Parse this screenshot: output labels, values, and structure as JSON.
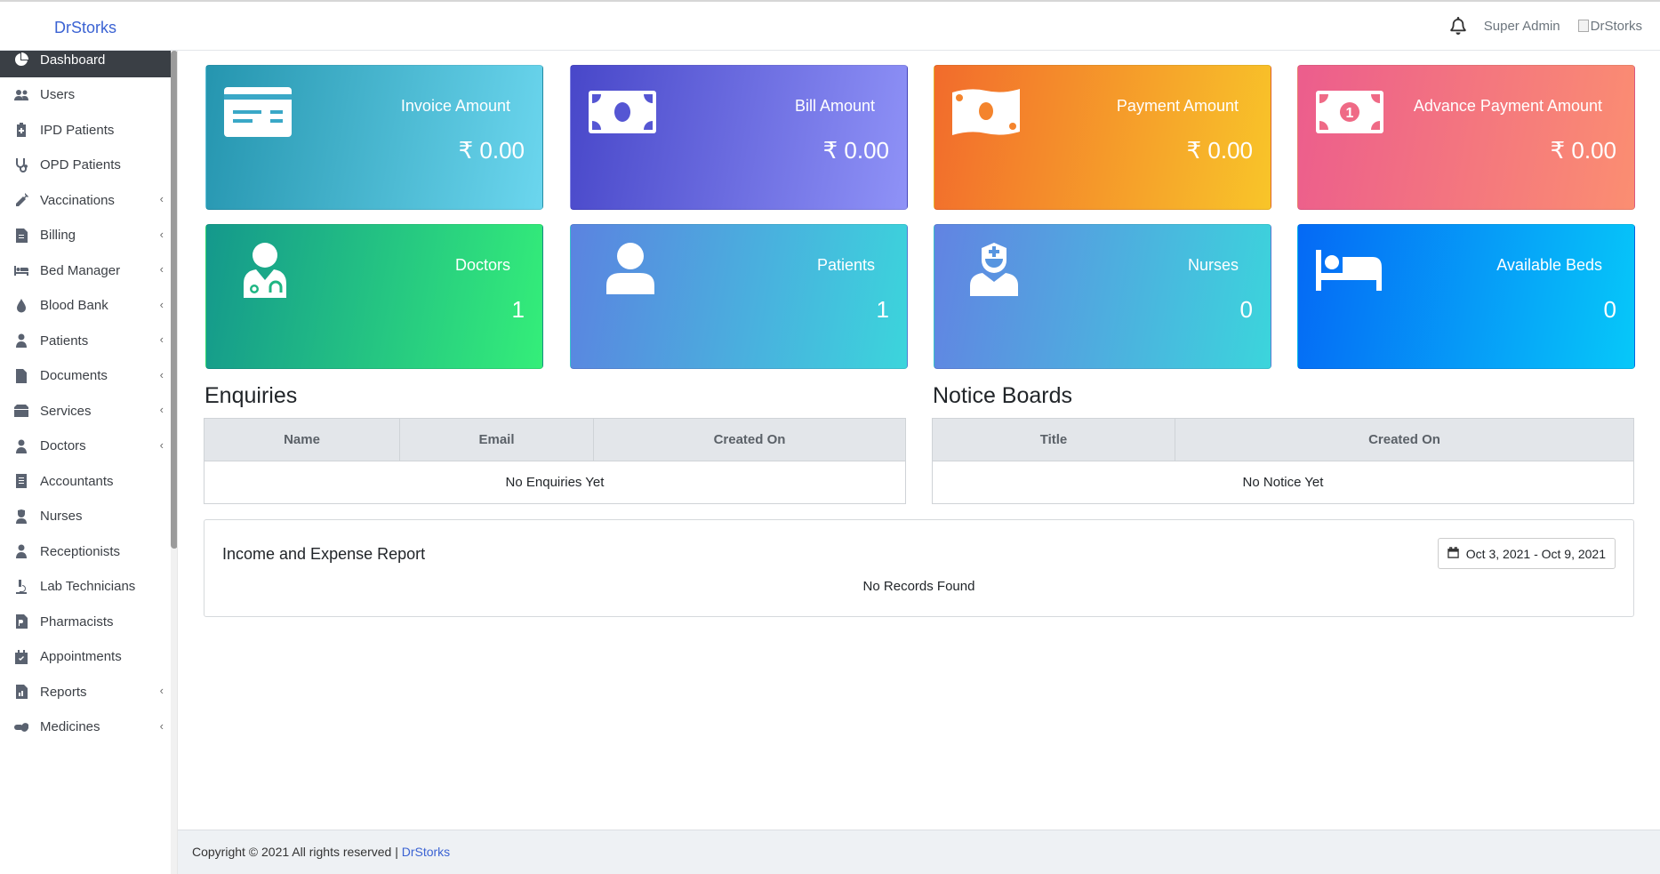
{
  "header": {
    "brand": "DrStorks",
    "user_name": "Super Admin",
    "avatar_alt": "DrStorks"
  },
  "sidebar": {
    "items": [
      {
        "label": "Dashboard",
        "icon": "pie-chart-icon",
        "active": true,
        "has_submenu": false
      },
      {
        "label": "Users",
        "icon": "users-icon",
        "has_submenu": false
      },
      {
        "label": "IPD Patients",
        "icon": "clipboard-plus-icon",
        "has_submenu": false
      },
      {
        "label": "OPD Patients",
        "icon": "stethoscope-icon",
        "has_submenu": false
      },
      {
        "label": "Vaccinations",
        "icon": "syringe-icon",
        "has_submenu": true
      },
      {
        "label": "Billing",
        "icon": "invoice-icon",
        "has_submenu": true
      },
      {
        "label": "Bed Manager",
        "icon": "bed-icon",
        "has_submenu": true
      },
      {
        "label": "Blood Bank",
        "icon": "blood-drop-icon",
        "has_submenu": true
      },
      {
        "label": "Patients",
        "icon": "patient-icon",
        "has_submenu": true
      },
      {
        "label": "Documents",
        "icon": "file-icon",
        "has_submenu": true
      },
      {
        "label": "Services",
        "icon": "box-icon",
        "has_submenu": true
      },
      {
        "label": "Doctors",
        "icon": "doctor-icon",
        "has_submenu": true
      },
      {
        "label": "Accountants",
        "icon": "ledger-icon",
        "has_submenu": false
      },
      {
        "label": "Nurses",
        "icon": "nurse-icon",
        "has_submenu": false
      },
      {
        "label": "Receptionists",
        "icon": "receptionist-icon",
        "has_submenu": false
      },
      {
        "label": "Lab Technicians",
        "icon": "microscope-icon",
        "has_submenu": false
      },
      {
        "label": "Pharmacists",
        "icon": "prescription-icon",
        "has_submenu": false
      },
      {
        "label": "Appointments",
        "icon": "calendar-check-icon",
        "has_submenu": false
      },
      {
        "label": "Reports",
        "icon": "report-icon",
        "has_submenu": true
      },
      {
        "label": "Medicines",
        "icon": "capsules-icon",
        "has_submenu": true
      }
    ],
    "caret": "‹"
  },
  "cards": [
    {
      "label": "Invoice Amount",
      "value": "₹ 0.00",
      "icon": "credit-card-icon"
    },
    {
      "label": "Bill Amount",
      "value": "₹ 0.00",
      "icon": "money-bill-icon"
    },
    {
      "label": "Payment Amount",
      "value": "₹ 0.00",
      "icon": "money-wave-icon"
    },
    {
      "label": "Advance Payment Amount",
      "value": "₹ 0.00",
      "icon": "money-bill-one-icon"
    },
    {
      "label": "Doctors",
      "value": "1",
      "icon": "user-doctor-icon"
    },
    {
      "label": "Patients",
      "value": "1",
      "icon": "user-icon"
    },
    {
      "label": "Nurses",
      "value": "0",
      "icon": "user-nurse-icon"
    },
    {
      "label": "Available Beds",
      "value": "0",
      "icon": "bed-icon"
    }
  ],
  "enquiries": {
    "title": "Enquiries",
    "columns": [
      "Name",
      "Email",
      "Created On"
    ],
    "empty": "No Enquiries Yet"
  },
  "notices": {
    "title": "Notice Boards",
    "columns": [
      "Title",
      "Created On"
    ],
    "empty": "No Notice Yet"
  },
  "report": {
    "title": "Income and Expense Report",
    "date_range": "Oct 3, 2021 - Oct 9, 2021",
    "empty": "No Records Found"
  },
  "footer": {
    "text": "Copyright © 2021 All rights reserved |",
    "link": "DrStorks"
  },
  "colors": {
    "brand": "#3b63d3",
    "sidebar_active": "#3a3f45"
  }
}
